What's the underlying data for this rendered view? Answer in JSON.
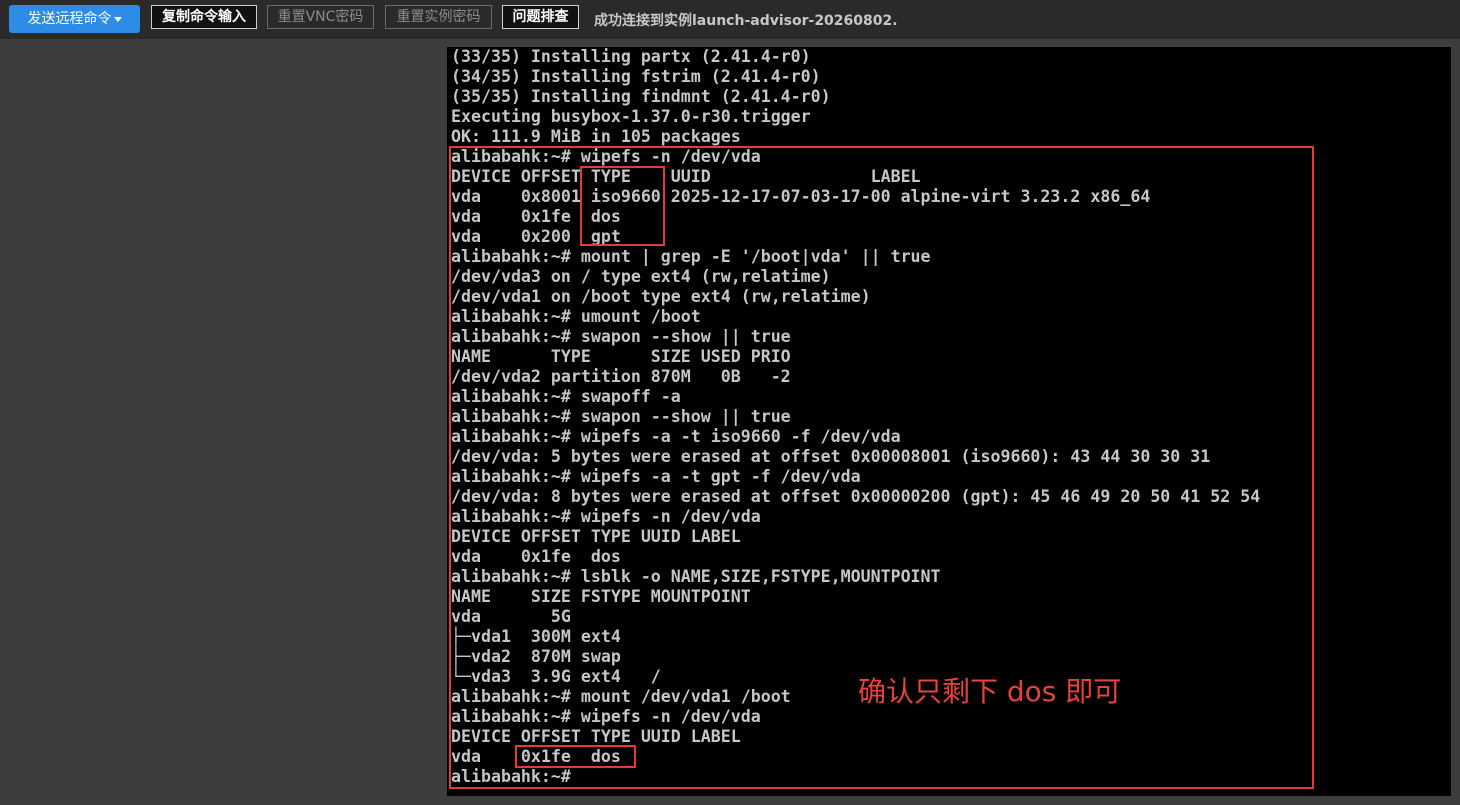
{
  "toolbar": {
    "send_remote_cmd": "发送远程命令",
    "copy_cmd_input": "复制命令输入",
    "reset_vnc_password": "重置VNC密码",
    "reset_instance_password": "重置实例密码",
    "troubleshoot": "问题排查",
    "status_message": "成功连接到实例launch-advisor-20260802."
  },
  "terminal": {
    "lines": [
      "(33/35) Installing partx (2.41.4-r0)",
      "(34/35) Installing fstrim (2.41.4-r0)",
      "(35/35) Installing findmnt (2.41.4-r0)",
      "Executing busybox-1.37.0-r30.trigger",
      "OK: 111.9 MiB in 105 packages",
      "alibabahk:~# wipefs -n /dev/vda",
      "DEVICE OFFSET TYPE    UUID                LABEL",
      "vda    0x8001 iso9660 2025-12-17-07-03-17-00 alpine-virt 3.23.2 x86_64",
      "vda    0x1fe  dos",
      "vda    0x200  gpt",
      "alibabahk:~# mount | grep -E '/boot|vda' || true",
      "/dev/vda3 on / type ext4 (rw,relatime)",
      "/dev/vda1 on /boot type ext4 (rw,relatime)",
      "alibabahk:~# umount /boot",
      "alibabahk:~# swapon --show || true",
      "NAME      TYPE      SIZE USED PRIO",
      "/dev/vda2 partition 870M   0B   -2",
      "alibabahk:~# swapoff -a",
      "alibabahk:~# swapon --show || true",
      "alibabahk:~# wipefs -a -t iso9660 -f /dev/vda",
      "/dev/vda: 5 bytes were erased at offset 0x00008001 (iso9660): 43 44 30 30 31",
      "alibabahk:~# wipefs -a -t gpt -f /dev/vda",
      "/dev/vda: 8 bytes were erased at offset 0x00000200 (gpt): 45 46 49 20 50 41 52 54",
      "alibabahk:~# wipefs -n /dev/vda",
      "DEVICE OFFSET TYPE UUID LABEL",
      "vda    0x1fe  dos",
      "alibabahk:~# lsblk -o NAME,SIZE,FSTYPE,MOUNTPOINT",
      "NAME    SIZE FSTYPE MOUNTPOINT",
      "vda       5G",
      "├─vda1  300M ext4",
      "├─vda2  870M swap",
      "└─vda3  3.9G ext4   /",
      "alibabahk:~# mount /dev/vda1 /boot",
      "alibabahk:~# wipefs -n /dev/vda",
      "DEVICE OFFSET TYPE UUID LABEL",
      "vda    0x1fe  dos",
      "alibabahk:~#"
    ]
  },
  "annotation": {
    "text": "确认只剩下 dos 即可",
    "color": "#e8413c"
  },
  "colors": {
    "accent": "#2e8ce6",
    "highlight_box": "#e03a3a"
  }
}
